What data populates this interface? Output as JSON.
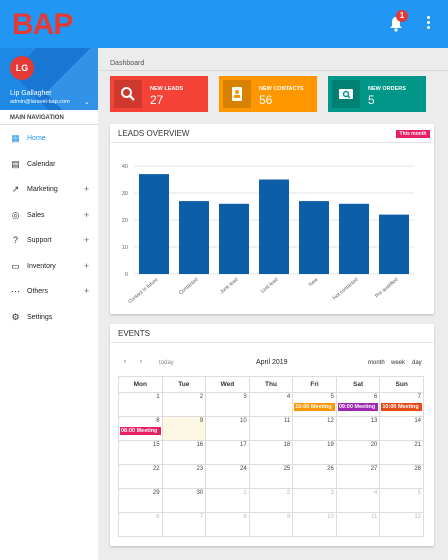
{
  "app": {
    "logo": "BAP",
    "notifications": "1"
  },
  "profile": {
    "initials": "LG",
    "name": "Lip Gallagher",
    "email": "admin@laravel-bap.com"
  },
  "nav": {
    "heading": "MAIN NAVIGATION",
    "items": [
      {
        "label": "Home",
        "icon": "grid-icon",
        "glyph": "▦",
        "expandable": false,
        "active": true
      },
      {
        "label": "Calendar",
        "icon": "calendar-icon",
        "glyph": "▤",
        "expandable": false
      },
      {
        "label": "Marketing",
        "icon": "trending-icon",
        "glyph": "↗",
        "expandable": true
      },
      {
        "label": "Sales",
        "icon": "target-icon",
        "glyph": "◎",
        "expandable": true
      },
      {
        "label": "Support",
        "icon": "help-icon",
        "glyph": "?",
        "expandable": true
      },
      {
        "label": "Inventory",
        "icon": "laptop-icon",
        "glyph": "▭",
        "expandable": true
      },
      {
        "label": "Others",
        "icon": "more-icon",
        "glyph": "⋯",
        "expandable": true
      },
      {
        "label": "Settings",
        "icon": "gear-icon",
        "glyph": "⚙",
        "expandable": false
      }
    ]
  },
  "breadcrumb": "Dashboard",
  "stats": [
    {
      "label": "NEW LEADS",
      "value": "27",
      "color": "#f44336",
      "icon": "search-icon"
    },
    {
      "label": "NEW CONTACTS",
      "value": "56",
      "color": "#ff9800",
      "icon": "contact-icon"
    },
    {
      "label": "NEW ORDERS",
      "value": "5",
      "color": "#009688",
      "icon": "orders-icon"
    }
  ],
  "leads_panel": {
    "title": "LEADS OVERVIEW",
    "badge": "This month"
  },
  "chart_data": {
    "type": "bar",
    "categories": [
      "Contact in future",
      "Contacted",
      "Junk lead",
      "Lost lead",
      "New",
      "Not contacted",
      "Pre qualified"
    ],
    "values": [
      37,
      27,
      26,
      35,
      27,
      26,
      22
    ],
    "ylim": [
      0,
      40
    ],
    "yticks": [
      0,
      10,
      20,
      30,
      40
    ],
    "color": "#0d5ea8",
    "grid": true
  },
  "events_panel": {
    "title": "EVENTS",
    "month": "April 2019",
    "today_label": "today",
    "views": [
      "month",
      "week",
      "day"
    ],
    "weekdays": [
      "Mon",
      "Tue",
      "Wed",
      "Thu",
      "Fri",
      "Sat",
      "Sun"
    ],
    "weeks": [
      [
        "1",
        "2",
        "3",
        "4",
        "5",
        "6",
        "7"
      ],
      [
        "8",
        "9",
        "10",
        "11",
        "12",
        "13",
        "14"
      ],
      [
        "15",
        "16",
        "17",
        "18",
        "19",
        "20",
        "21"
      ],
      [
        "22",
        "23",
        "24",
        "25",
        "26",
        "27",
        "28"
      ],
      [
        "29",
        "30",
        "1",
        "2",
        "3",
        "4",
        "5"
      ],
      [
        "6",
        "7",
        "8",
        "9",
        "10",
        "11",
        "12"
      ]
    ],
    "events": [
      {
        "week": 0,
        "day": 4,
        "text": "10:00 Meeting",
        "color": "#ff9800"
      },
      {
        "week": 0,
        "day": 5,
        "text": "09:00 Meeting",
        "color": "#9c27b0"
      },
      {
        "week": 0,
        "day": 6,
        "text": "10:00 Meeting",
        "color": "#e64a19"
      },
      {
        "week": 1,
        "day": 0,
        "text": "08:00 Meeting",
        "color": "#e91e63"
      }
    ]
  }
}
